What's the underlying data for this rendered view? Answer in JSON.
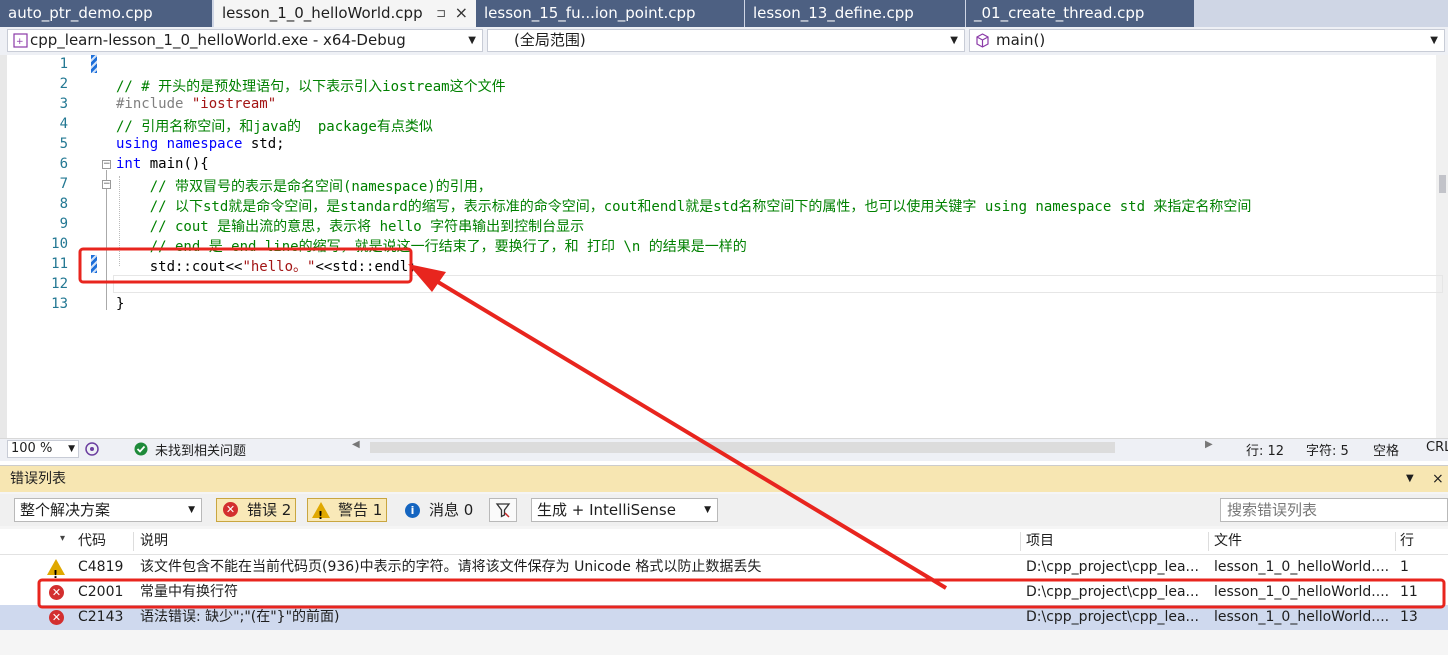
{
  "tabs": [
    {
      "label": "auto_ptr_demo.cpp"
    },
    {
      "label": "lesson_1_0_helloWorld.cpp",
      "pin": "⊐",
      "close": "×"
    },
    {
      "label": "lesson_15_fu...ion_point.cpp"
    },
    {
      "label": "lesson_13_define.cpp"
    },
    {
      "label": "_01_create_thread.cpp"
    }
  ],
  "nav": {
    "project": "cpp_learn-lesson_1_0_helloWorld.exe - x64-Debug",
    "scope": "(全局范围)",
    "member": "main()"
  },
  "editor": {
    "line_numbers": [
      "1",
      "2",
      "3",
      "4",
      "5",
      "6",
      "7",
      "8",
      "9",
      "10",
      "11",
      "12",
      "13"
    ],
    "lines": {
      "l2": "// # 开头的是预处理语句，以下表示引入iostream这个文件",
      "l3_pp": "#include ",
      "l3_str": "\"iostream\"",
      "l4": "// 引用名称空间，和java的  package有点类似",
      "l5_kw": "using namespace",
      "l5_rest": " std;",
      "l6_kw": "int",
      "l6_rest": " main(){",
      "l7": "    // 带双冒号的表示是命名空间(namespace)的引用，",
      "l8": "    // 以下std就是命令空间，是standard的缩写，表示标准的命令空间，cout和endl就是std名称空间下的属性，也可以使用关键字 using namespace std 来指定名称空间",
      "l9": "    // cout 是输出流的意思，表示将 hello 字符串输出到控制台显示",
      "l10": "    // end 是 end line的缩写，就是说这一行结束了，要换行了，和 打印 \\n 的结果是一样的",
      "l11_a": "    std::cout<<",
      "l11_str": "\"hello。\"",
      "l11_b": "<<std::endl;",
      "l13": "}"
    }
  },
  "editor_status": {
    "zoom": "100 %",
    "issues": "未找到相关问题",
    "line": "行: 12",
    "char": "字符: 5",
    "mode": "空格",
    "eol": "CRL"
  },
  "error_list": {
    "title": "错误列表",
    "scope": "整个解决方案",
    "errors_btn": "错误 2",
    "warnings_btn": "警告 1",
    "messages_btn": "消息 0",
    "build_filter": "生成 + IntelliSense",
    "search_placeholder": "搜索错误列表",
    "columns": {
      "code": "代码",
      "desc": "说明",
      "project": "项目",
      "file": "文件",
      "line": "行"
    },
    "rows": [
      {
        "type": "warning",
        "code": "C4819",
        "desc": "该文件包含不能在当前代码页(936)中表示的字符。请将该文件保存为 Unicode 格式以防止数据丢失",
        "project": "D:\\cpp_project\\cpp_lea...",
        "file": "lesson_1_0_helloWorld....",
        "line": "1"
      },
      {
        "type": "error",
        "code": "C2001",
        "desc": "常量中有换行符",
        "project": "D:\\cpp_project\\cpp_lea...",
        "file": "lesson_1_0_helloWorld....",
        "line": "11"
      },
      {
        "type": "error",
        "code": "C2143",
        "desc": "语法错误: 缺少\";\"(在\"}\"的前面)",
        "project": "D:\\cpp_project\\cpp_lea...",
        "file": "lesson_1_0_helloWorld....",
        "line": "13"
      }
    ]
  },
  "colors": {
    "highlight_red": "#e8251e",
    "tab_active": "#f5f5f5",
    "tab_inactive": "#4d6082",
    "error_header": "#f7e6b2"
  }
}
